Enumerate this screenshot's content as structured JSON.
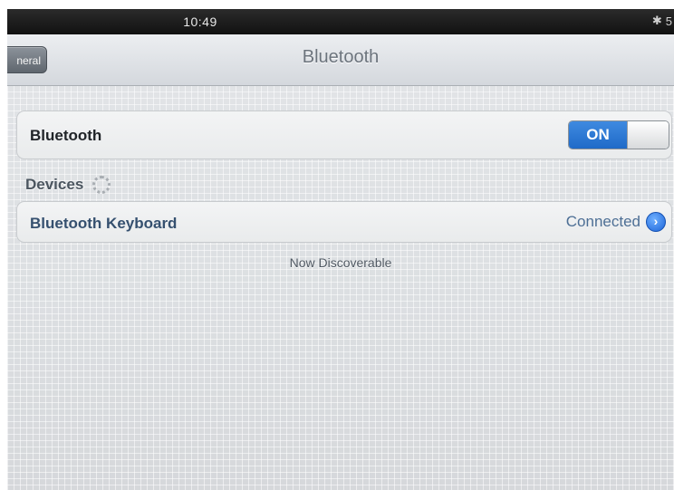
{
  "status_bar": {
    "time": "10:49",
    "bluetooth_icon": "bluetooth-icon",
    "battery_text": "5"
  },
  "nav": {
    "back_label": "neral",
    "title": "Bluetooth"
  },
  "bluetooth_row": {
    "label": "Bluetooth",
    "toggle_label": "ON",
    "toggle_state": "on"
  },
  "devices": {
    "header": "Devices",
    "spinner_icon": "spinner-icon",
    "items": [
      {
        "name": "Bluetooth Keyboard",
        "status": "Connected",
        "detail_icon": "detail-disclosure-icon"
      }
    ]
  },
  "footer_note": "Now Discoverable",
  "colors": {
    "toggle_on": "#2c78d8",
    "device_name": "#35506f",
    "device_status": "#4d6f95",
    "nav_title": "#6b737c"
  }
}
